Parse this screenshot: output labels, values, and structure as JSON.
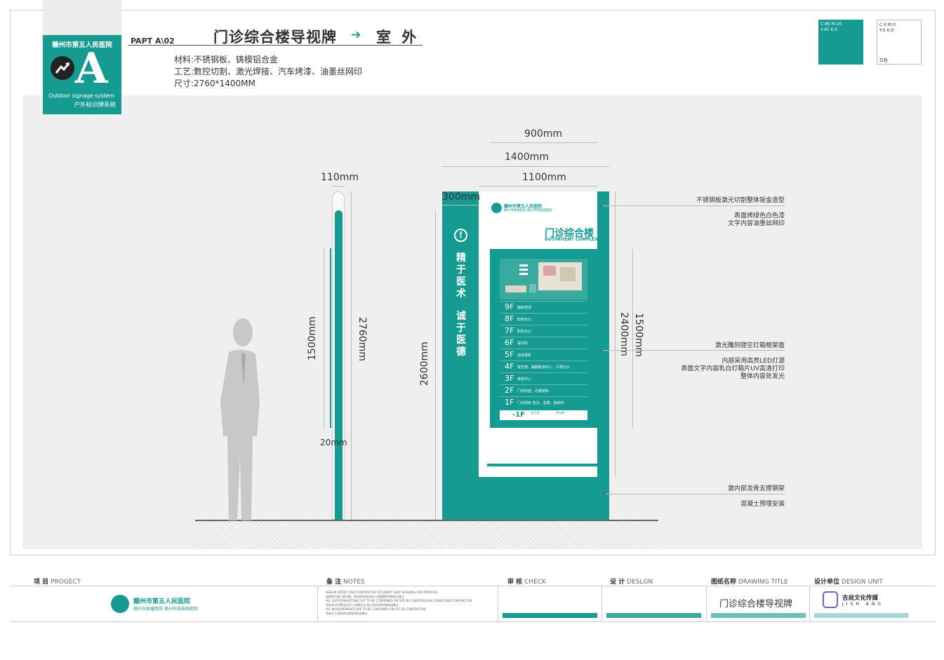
{
  "brand": {
    "hospital_name": "赣州市第五人民医院",
    "letter": "A",
    "system_en": "Outdoor signage system",
    "system_cn": "户外标识牌系统",
    "color": "#159b91"
  },
  "header": {
    "code": "PAPT  A\\02",
    "title": "门诊综合楼导视牌",
    "arrow": "➔",
    "location": "室 外"
  },
  "specs": {
    "material": "材料:不锈钢板、铸模铝合金",
    "process": "工艺:数控切割、激光焊接、汽车烤漆、油墨丝网印",
    "size": "尺寸:2760*1400MM"
  },
  "swatches": [
    {
      "label": "C:80 M:20\nY:45 K:0",
      "color": "#159b91",
      "name": ""
    },
    {
      "label": "C:0 M:0\nY:0 K:0",
      "color": "#ffffff",
      "name": "白色"
    }
  ],
  "dimensions": {
    "w900": "900mm",
    "w1400": "1400mm",
    "w1100": "1100mm",
    "w300": "300mm",
    "w110": "110mm",
    "w20": "20mm",
    "h1500_left": "1500mm",
    "h2760": "2760mm",
    "h2600": "2600mm",
    "h2400": "2400mm",
    "h1500_right": "1500mm"
  },
  "notes": {
    "n1": "不锈钢板激光切割整体钣金造型",
    "n2a": "表面烤绿色白色漆",
    "n2b": "文字内容油墨丝网印",
    "n3": "激光雕刻镂空灯箱框架面",
    "n4a": "内部采用高亮LED灯源",
    "n4b": "表面文字内容乳白灯箱片UV高清打印",
    "n4c": "整体内容处发光",
    "n5": "激内部龙骨支撑钢架",
    "n6": "混凝土预埋安装"
  },
  "sign": {
    "slogan_top": "精于医术",
    "slogan_bottom": "诚于医德",
    "info_icon": "!",
    "hospital_cn": "赣州市第五人民医院",
    "hospital_sub": "赣州市肿瘤医院  赣州市结核病医院",
    "building_cn": "门诊综合楼",
    "building_en": "OUTPATIENT COMPLEX",
    "floors": [
      {
        "floor": "9F",
        "desc": "临床培训"
      },
      {
        "floor": "8F",
        "desc": "职务办公"
      },
      {
        "floor": "7F",
        "desc": "职务办公"
      },
      {
        "floor": "6F",
        "desc": "肾内科"
      },
      {
        "floor": "5F",
        "desc": "血液透析"
      },
      {
        "floor": "4F",
        "desc": "院史馆、静脉配液中心、行政办公"
      },
      {
        "floor": "3F",
        "desc": "体检中心"
      },
      {
        "floor": "2F",
        "desc": "门诊科室、内窥镜科"
      },
      {
        "floor": "1F",
        "desc": "门诊药房  急诊、急救、放射科"
      }
    ],
    "basement": {
      "floor": "-1F",
      "desc1": "地下室",
      "desc2": "停车库"
    }
  },
  "footer": {
    "project_label": "项 目",
    "project_en": "PROGECT",
    "notes_label": "备 注",
    "notes_en": "NOTES",
    "check_label": "审 核",
    "check_en": "CHECK",
    "design_label": "设 计",
    "design_en": "DESLGN",
    "drawing_label": "图纸名称",
    "drawing_en": "DRAWING TITLE",
    "unit_label": "设计单位",
    "unit_en": "DESIGN UNIT",
    "hospital_name": "赣州市第五人民医院",
    "hospital_sub": "赣州市肿瘤医院  赣州市结核病医院",
    "drawing_title": "门诊综合楼导视牌",
    "design_company": "吉尚文化传媒",
    "design_company_en": "JISH ANG",
    "notes_lines": [
      "DESIGN INTENT ONLY CONTRACTOR TO SUBMIT SHOP DRAWING FOR APPROVAL",
      "此图纸为施工意向图，承包商须递交施工详细图纸供审批后施工",
      "ALL LOCATION/SETTING OUT TO BE CONFIRMED ON SITE BY CLIENT/DESIGN CONSULTANT/CONTRACTOR",
      "所有标识位置/标识尺寸须按业主/设计顾问/承包商现场确认",
      "ALL MEASUREMENTS ARE TO BE CONFIRMED ON SITE BY CONTRACTOR",
      "所有尺寸须由承包商现场核实确认"
    ]
  }
}
